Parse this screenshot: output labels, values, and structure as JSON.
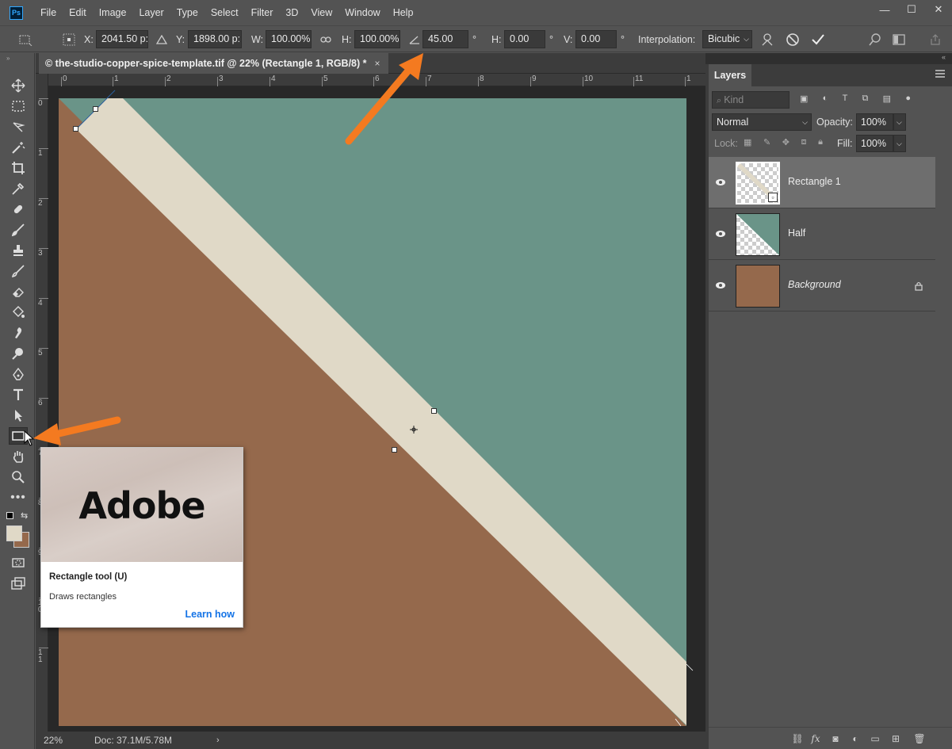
{
  "app": {
    "logo": "Ps"
  },
  "menu": [
    "File",
    "Edit",
    "Image",
    "Layer",
    "Type",
    "Select",
    "Filter",
    "3D",
    "View",
    "Window",
    "Help"
  ],
  "window_controls": {
    "minimize": "—",
    "maximize": "☐",
    "close": "✕"
  },
  "options": {
    "x_label": "X:",
    "x_value": "2041.50 p:",
    "y_label": "Y:",
    "y_value": "1898.00 p:",
    "w_label": "W:",
    "w_value": "100.00%",
    "h_label": "H:",
    "h_value": "100.00%",
    "angle_value": "45.00",
    "angle_unit": "°",
    "hskew_label": "H:",
    "hskew_value": "0.00",
    "hskew_unit": "°",
    "vskew_label": "V:",
    "vskew_value": "0.00",
    "vskew_unit": "°",
    "interp_label": "Interpolation:",
    "interp_value": "Bicubic"
  },
  "document": {
    "tab_title": "© the-studio-copper-spice-template.tif @ 22% (Rectangle 1, RGB/8) *",
    "tab_close": "×",
    "zoom": "22%",
    "doc_info": "Doc: 37.1M/5.78M",
    "ruler_top": [
      "0",
      "1",
      "2",
      "3",
      "4",
      "5",
      "6",
      "7",
      "8",
      "9",
      "10",
      "11",
      "1"
    ],
    "ruler_left": [
      "0",
      "1",
      "2",
      "3",
      "4",
      "5",
      "6",
      "7",
      "8",
      "9",
      "10",
      "11"
    ]
  },
  "canvas_colors": {
    "teal": "#6a9488",
    "brown": "#95694c",
    "stripe": "#e0d9c7"
  },
  "tooltip": {
    "image_text": "Adobe",
    "title": "Rectangle tool (U)",
    "description": "Draws rectangles",
    "link": "Learn how"
  },
  "layers_panel": {
    "tab": "Layers",
    "filter_placeholder": "Kind",
    "blend_mode": "Normal",
    "opacity_label": "Opacity:",
    "opacity_value": "100%",
    "lock_label": "Lock:",
    "fill_label": "Fill:",
    "fill_value": "100%",
    "layers": [
      {
        "name": "Rectangle 1",
        "selected": true
      },
      {
        "name": "Half",
        "selected": false
      },
      {
        "name": "Background",
        "selected": false,
        "locked": true
      }
    ]
  },
  "accent_colors": {
    "arrow": "#f47a20",
    "link": "#1473e6",
    "ps_blue": "#31a8ff"
  }
}
